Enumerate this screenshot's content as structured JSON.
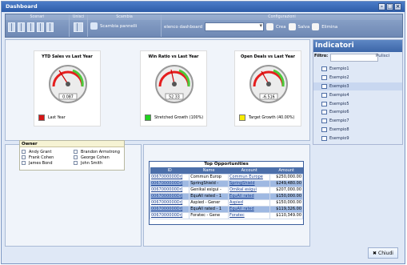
{
  "window": {
    "title": "Dashboard"
  },
  "toolbar": {
    "groups": {
      "scenari": "Scenari",
      "unisci": "Unisci",
      "scambia": "Scambia",
      "configurazioni": "Configurazioni"
    },
    "scambia_pannelli": "Scambia pannelli",
    "elenco_label": "elenco dashboard",
    "crea": "Crea",
    "salva": "Salva",
    "elimina": "Elimina"
  },
  "gauges": [
    {
      "title": "YTD Sales vs Last Year",
      "value": "0.087",
      "legend": "Last Year",
      "color": "#d61616"
    },
    {
      "title": "Win Ratio vs Last Year",
      "value": "52.33",
      "legend": "Stretched Growth (100%)",
      "color": "#20d31f"
    },
    {
      "title": "Open Deals vs Last Year",
      "value": "-6.516",
      "legend": "Target Growth (40.00%)",
      "color": "#f7ec00"
    }
  ],
  "owner": {
    "header": "Owner",
    "people": [
      "Andy Grant",
      "Brandon Armstrong",
      "Frank Cohen",
      "George Cohen",
      "James Bond",
      "John Smith"
    ]
  },
  "opportunities": {
    "title": "Top Opportunities",
    "columns": [
      "ID",
      "Name",
      "Account",
      "Amount"
    ],
    "rows": [
      [
        "0067000000DrJ",
        "Commun Europ",
        "Commun Europe",
        "$250,000.00"
      ],
      [
        "0067000000DrJ",
        "SpringShield -",
        "SpringShield",
        "$249,480.00"
      ],
      [
        "0067000000DrJ",
        "Genikal esigui -",
        "Omikal esigui",
        "$207,000.00"
      ],
      [
        "0067000000DrJ",
        "EquAll rated - 1",
        "EquAll rated",
        "$150,000.00"
      ],
      [
        "0067000000DrJ",
        "Aspied - Gener",
        "Aspied",
        "$150,000.00"
      ],
      [
        "0067000000DrJ",
        "EquAll rated - 1",
        "EquAll rated",
        "$119,326.00"
      ],
      [
        "0067000000DrJ",
        "Foratec - Gene",
        "Foratec",
        "$110,349.00"
      ]
    ]
  },
  "indicatori": {
    "title": "Indicatori",
    "filter_label": "Filtro:",
    "clear": "Pulisci",
    "items": [
      "Esempio1",
      "Esempio2",
      "Esempio3",
      "Esempio4",
      "Esempio5",
      "Esempio6",
      "Esempio7",
      "Esempio8",
      "Esempio9"
    ]
  },
  "footer": {
    "close": "Chiudi"
  }
}
